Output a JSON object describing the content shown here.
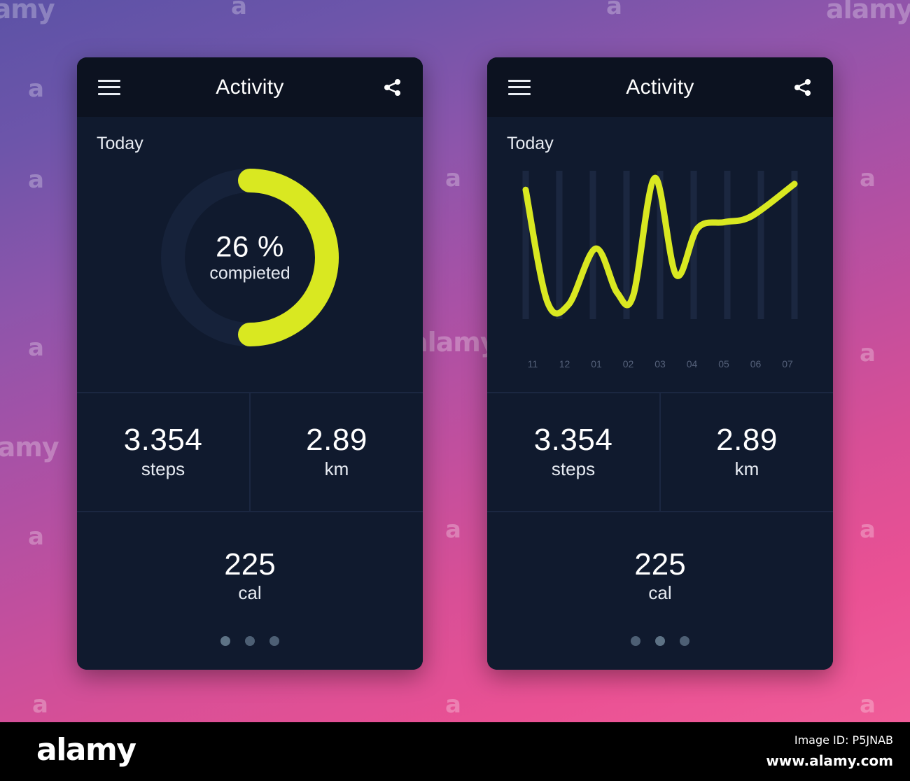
{
  "background": {
    "gradient_top": "#5c52a6",
    "gradient_mid": "#a851a6",
    "gradient_bottom": "#f05d99"
  },
  "theme": {
    "accent": "#d9e821",
    "card_bg": "#101a2e",
    "topbar_bg": "#0c1220",
    "divider": "#1b2741",
    "text_primary": "#ffffff",
    "text_secondary": "#e7ebf2"
  },
  "watermarks": {
    "letter": "a",
    "word": "alamy"
  },
  "phones": [
    {
      "id": "progress-screen",
      "topbar": {
        "menu_icon": "hamburger-icon",
        "title": "Activity",
        "share_icon": "share-icon"
      },
      "section_label": "Today",
      "hero_type": "ring",
      "ring": {
        "percent_label": "26 %",
        "caption": "compieted",
        "percent_value": 26,
        "track_color": "#172338",
        "progress_color": "#d9e821"
      },
      "stats": [
        {
          "value": "3.354",
          "unit": "steps"
        },
        {
          "value": "2.89",
          "unit": "km"
        }
      ],
      "calories": {
        "value": "225",
        "unit": "cal"
      },
      "pagination": {
        "count": 3,
        "active_index": 0
      }
    },
    {
      "id": "chart-screen",
      "topbar": {
        "menu_icon": "hamburger-icon",
        "title": "Activity",
        "share_icon": "share-icon"
      },
      "section_label": "Today",
      "hero_type": "chart",
      "stats": [
        {
          "value": "3.354",
          "unit": "steps"
        },
        {
          "value": "2.89",
          "unit": "km"
        }
      ],
      "calories": {
        "value": "225",
        "unit": "cal"
      },
      "pagination": {
        "count": 3,
        "active_index": 1
      }
    }
  ],
  "chart_data": {
    "type": "line",
    "title": "",
    "xlabel": "",
    "ylabel": "",
    "categories": [
      "11",
      "12",
      "01",
      "02",
      "03",
      "04",
      "05",
      "06",
      "07"
    ],
    "values": [
      88,
      12,
      10,
      48,
      18,
      16,
      96,
      30,
      62,
      66,
      70,
      92
    ],
    "x": [
      0,
      8,
      16,
      26,
      34,
      40,
      48,
      56,
      64,
      74,
      84,
      100
    ],
    "ylim": [
      0,
      100
    ],
    "grid": "vertical-bars",
    "grid_color": "#1b2740",
    "line_color": "#d9e821",
    "legend": "none",
    "tick_label_color": "#55617a"
  },
  "footer": {
    "logo": "alamy",
    "image_id": "Image ID: P5JNAB",
    "url": "www.alamy.com"
  }
}
